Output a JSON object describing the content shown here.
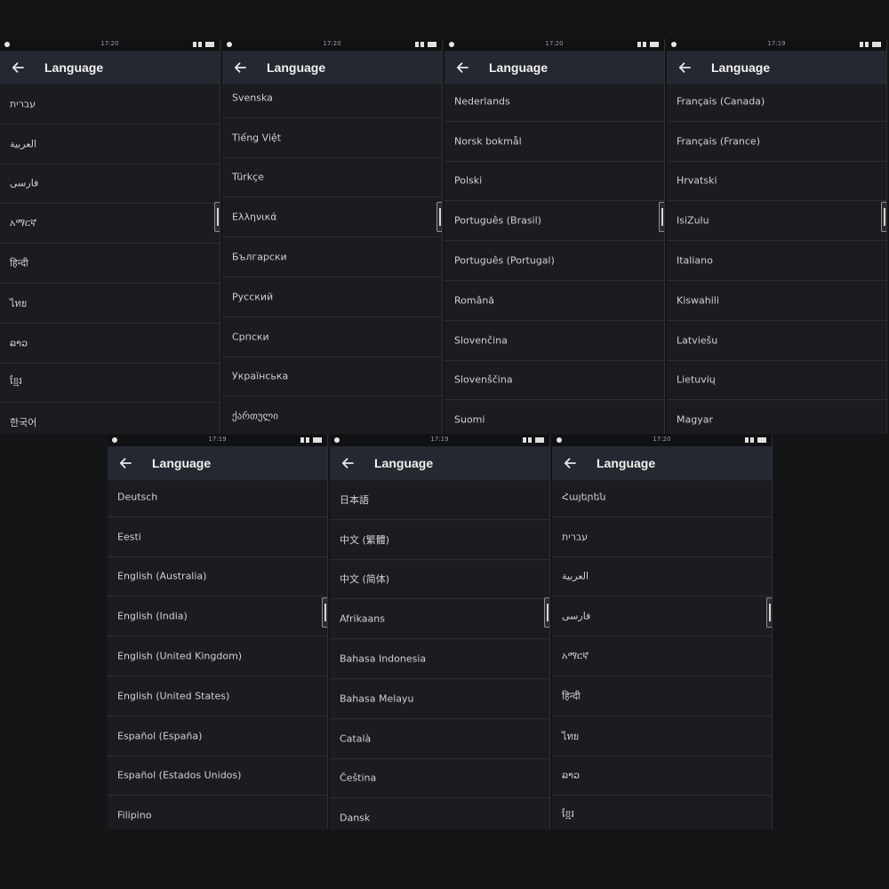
{
  "title": "Language",
  "screens": [
    {
      "time": "17:20",
      "items": [
        "עברית",
        "العربية",
        "فارسی",
        "አማርኛ",
        "हिन्दी",
        "ไทย",
        "ລາວ",
        "ខ្មែរ",
        "한국어"
      ]
    },
    {
      "time": "17:20",
      "items": [
        "Svenska",
        "Tiếng Việt",
        "Türkçe",
        "Ελληνικά",
        "Български",
        "Русский",
        "Српски",
        "Українська",
        "ქართული"
      ]
    },
    {
      "time": "17:20",
      "items": [
        "Nederlands",
        "Norsk bokmål",
        "Polski",
        "Português (Brasil)",
        "Português (Portugal)",
        "Română",
        "Slovenčina",
        "Slovenščina",
        "Suomi"
      ]
    },
    {
      "time": "17:19",
      "items": [
        "Français (Canada)",
        "Français (France)",
        "Hrvatski",
        "IsiZulu",
        "Italiano",
        "Kiswahili",
        "Latviešu",
        "Lietuvių",
        "Magyar"
      ]
    },
    {
      "time": "17:19",
      "items": [
        "Deutsch",
        "Eesti",
        "English (Australia)",
        "English (India)",
        "English (United Kingdom)",
        "English (United States)",
        "Español (España)",
        "Español (Estados Unidos)",
        "Filipino"
      ]
    },
    {
      "time": "17:19",
      "items": [
        "日本語",
        "中文 (繁體)",
        "中文 (简体)",
        "Afrikaans",
        "Bahasa Indonesia",
        "Bahasa Melayu",
        "Català",
        "Čeština",
        "Dansk"
      ]
    },
    {
      "time": "17:20",
      "items": [
        "Հայերեն",
        "עברית",
        "العربية",
        "فارسی",
        "አማርኛ",
        "हिन्दी",
        "ไทย",
        "ລາວ",
        "ខ្មែរ"
      ]
    }
  ]
}
